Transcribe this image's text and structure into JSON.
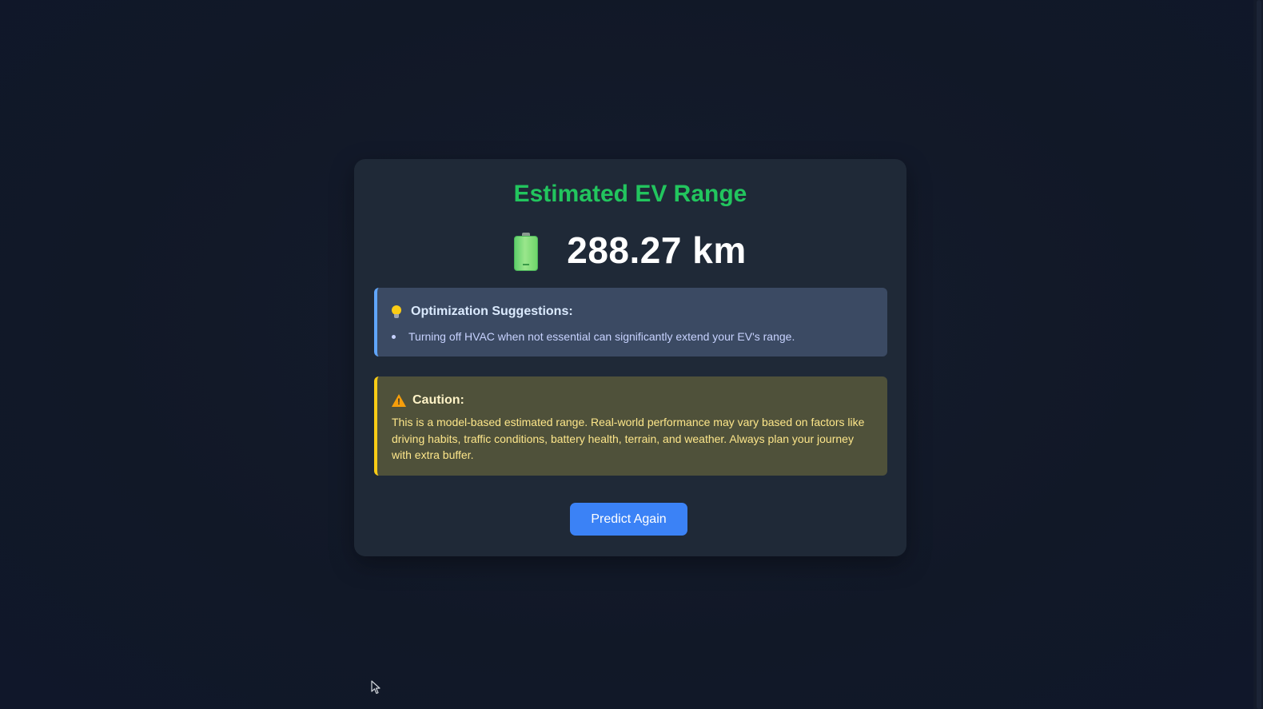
{
  "result": {
    "title": "Estimated EV Range",
    "range_value": "288.27 km",
    "range_icon": "battery-icon"
  },
  "suggestions": {
    "icon": "lightbulb-icon",
    "title": "Optimization Suggestions:",
    "items": [
      "Turning off HVAC when not essential can significantly extend your EV's range."
    ]
  },
  "caution": {
    "icon": "warning-icon",
    "title": "Caution:",
    "text": "This is a model-based estimated range. Real-world performance may vary based on factors like driving habits, traffic conditions, battery health, terrain, and weather. Always plan your journey with extra buffer."
  },
  "actions": {
    "predict_again_label": "Predict Again"
  },
  "colors": {
    "background": "#111827",
    "card": "#1f2937",
    "title_green": "#22c55e",
    "suggestion_accent": "#60a5fa",
    "caution_accent": "#facc15",
    "button_blue": "#3b82f6"
  }
}
